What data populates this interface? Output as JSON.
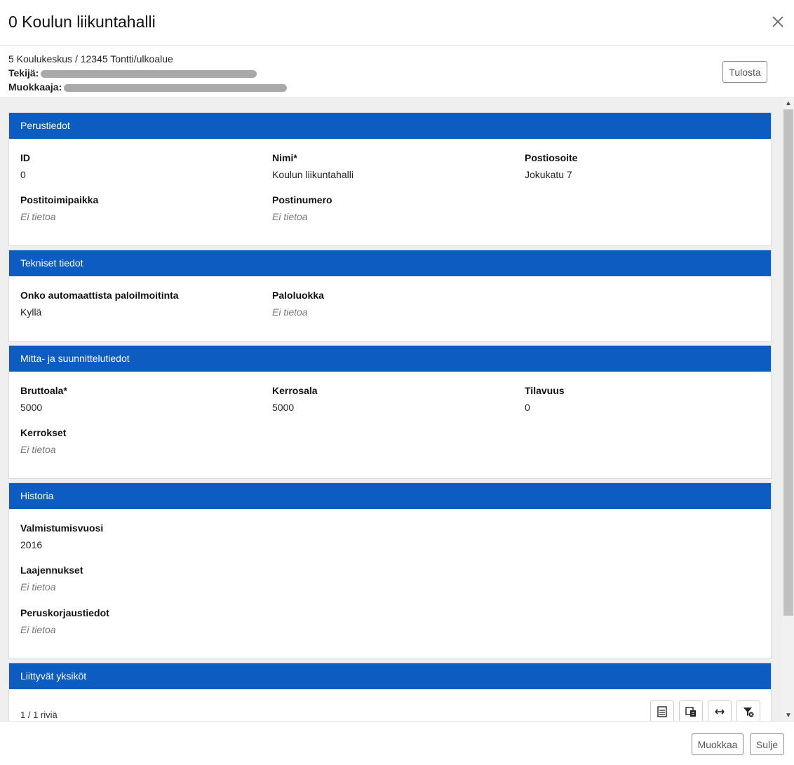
{
  "title": "0 Koulun liikuntahalli",
  "meta": {
    "path": "5 Koulukeskus / 12345 Tontti/ulkoalue",
    "creator_label": "Tekijä:",
    "modifier_label": "Muokkaaja:"
  },
  "print_label": "Tulosta",
  "sections": {
    "perustiedot": {
      "title": "Perustiedot",
      "id_label": "ID",
      "id_value": "0",
      "nimi_label": "Nimi*",
      "nimi_value": "Koulun liikuntahalli",
      "postiosoite_label": "Postiosoite",
      "postiosoite_value": "Jokukatu 7",
      "postitoimipaikka_label": "Postitoimipaikka",
      "postitoimipaikka_value": "Ei tietoa",
      "postinumero_label": "Postinumero",
      "postinumero_value": "Ei tietoa"
    },
    "tekniset": {
      "title": "Tekniset tiedot",
      "palo_label": "Onko automaattista paloilmoitinta",
      "palo_value": "Kyllä",
      "paloluokka_label": "Paloluokka",
      "paloluokka_value": "Ei tietoa"
    },
    "mitta": {
      "title": "Mitta- ja suunnittelutiedot",
      "brutto_label": "Bruttoala*",
      "brutto_value": "5000",
      "kerrosala_label": "Kerrosala",
      "kerrosala_value": "5000",
      "tilavuus_label": "Tilavuus",
      "tilavuus_value": "0",
      "kerrokset_label": "Kerrokset",
      "kerrokset_value": "Ei tietoa"
    },
    "historia": {
      "title": "Historia",
      "valm_label": "Valmistumisvuosi",
      "valm_value": "2016",
      "laaj_label": "Laajennukset",
      "laaj_value": "Ei tietoa",
      "perus_label": "Peruskorjaustiedot",
      "perus_value": "Ei tietoa"
    },
    "liittyvat": {
      "title": "Liittyvät yksiköt",
      "rows": "1 / 1 riviä"
    }
  },
  "footer": {
    "edit_label": "Muokkaa",
    "close_label": "Sulje"
  }
}
